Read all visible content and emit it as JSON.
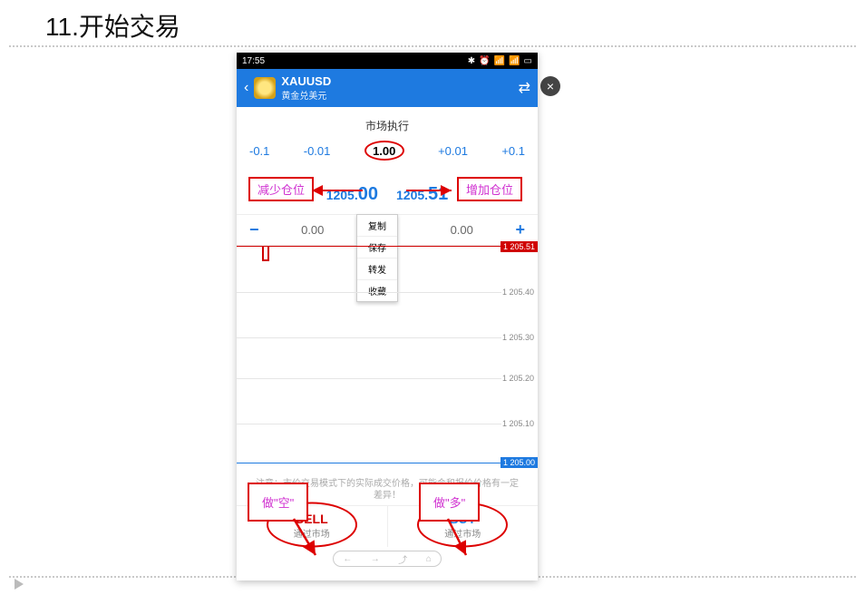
{
  "document": {
    "section_number": "11.",
    "section_title": "开始交易"
  },
  "phone": {
    "status_time": "17:55",
    "header": {
      "symbol": "XAUUSD",
      "symbol_sub": "黄金兑美元"
    },
    "execution_label": "市场执行",
    "lot_steps": {
      "dec_large": "-0.1",
      "dec_small": "-0.01",
      "value": "1.00",
      "inc_small": "+0.01",
      "inc_large": "+0.1"
    },
    "prices": {
      "bid_whole": "1205.",
      "bid_frac": "00",
      "ask_whole": "1205.",
      "ask_frac": "51"
    },
    "sltp": {
      "sl": "0.00",
      "tp": "0.00"
    },
    "context_menu": [
      "复制",
      "保存",
      "转发",
      "收藏"
    ],
    "chart_levels": [
      "1 205.51",
      "1 205.40",
      "1 205.30",
      "1 205.20",
      "1 205.10",
      "1 205.00"
    ],
    "notice": "注意：市价交易模式下的实际成交价格，可能会和报价价格有一定差异！",
    "sell": {
      "label": "SELL",
      "sub": "通过市场"
    },
    "buy": {
      "label": "BUY",
      "sub": "通过市场"
    }
  },
  "annotations": {
    "reduce": "减少仓位",
    "increase": "增加仓位",
    "short": "做\"空\"",
    "long": "做\"多\""
  },
  "close_badge": "×"
}
